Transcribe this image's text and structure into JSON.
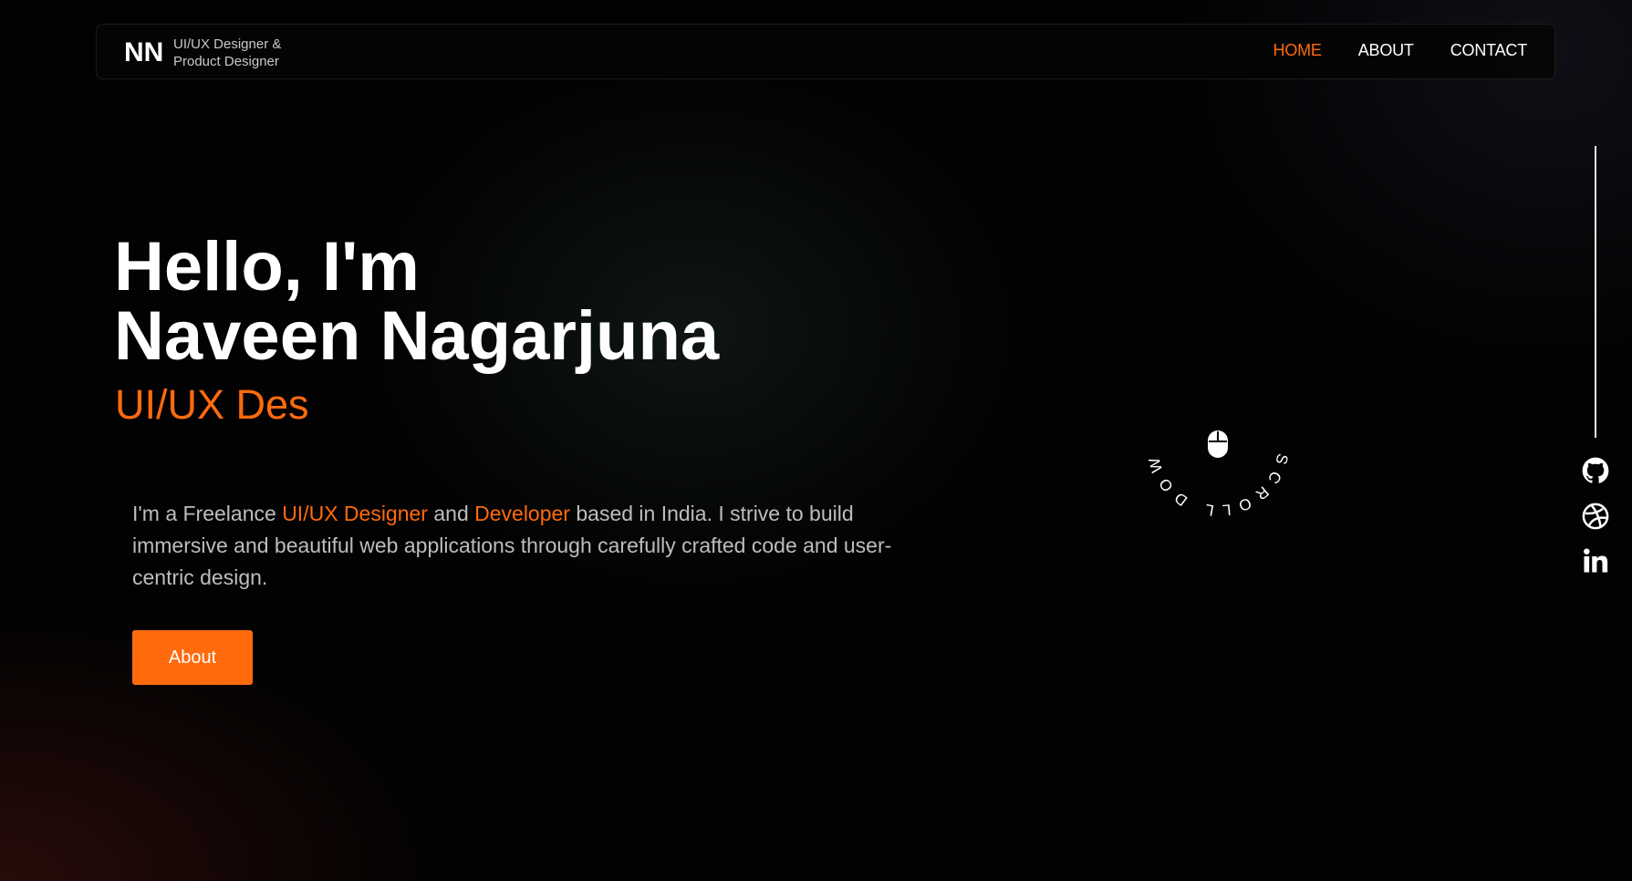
{
  "navbar": {
    "logo": "NN",
    "logo_subtitle_line1": "UI/UX Designer &",
    "logo_subtitle_line2": "Product Designer",
    "links": [
      {
        "label": "HOME",
        "active": true
      },
      {
        "label": "ABOUT",
        "active": false
      },
      {
        "label": "CONTACT",
        "active": false
      }
    ]
  },
  "hero": {
    "greeting": "Hello, I'm",
    "name": "Naveen Nagarjuna",
    "role_typed": "UI/UX Des",
    "description": {
      "part1": "I'm a Freelance ",
      "highlight1": "UI/UX Designer",
      "part2": " and ",
      "highlight2": "Developer",
      "part3": " based in India. I strive to build immersive and beautiful web applications through carefully crafted code and user-centric design."
    },
    "button_label": "About"
  },
  "scroll_badge": {
    "text": "SCROLL DOWN •",
    "icon": "mouse-icon"
  },
  "social": {
    "icons": [
      "github-icon",
      "dribbble-icon",
      "linkedin-icon"
    ]
  },
  "colors": {
    "accent": "#ff6a0d",
    "background": "#020202",
    "text": "#ffffff",
    "muted_text": "#bdbdbd"
  }
}
